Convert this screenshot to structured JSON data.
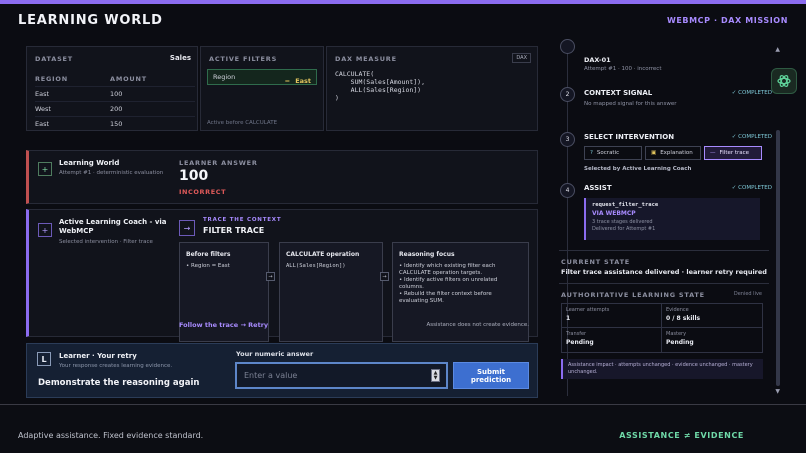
{
  "header": {
    "title": "LEARNING WORLD",
    "mission": "WEBMCP · DAX MISSION"
  },
  "dataset": {
    "label": "DATASET",
    "table_name": "Sales",
    "columns": [
      "REGION",
      "AMOUNT"
    ],
    "rows": [
      [
        "East",
        "100"
      ],
      [
        "West",
        "200"
      ],
      [
        "East",
        "150"
      ]
    ]
  },
  "active_filters": {
    "label": "ACTIVE FILTERS",
    "field": "Region",
    "op": "=",
    "value": "East",
    "note": "Active before CALCULATE"
  },
  "dax_measure": {
    "label": "DAX MEASURE",
    "tag": "DAX",
    "code": "CALCULATE(\n    SUM(Sales[Amount]),\n    ALL(Sales[Region])\n)"
  },
  "learning_world": {
    "title": "Learning World",
    "subtitle": "Attempt #1 · deterministic evaluation",
    "answer_label": "LEARNER ANSWER",
    "answer": "100",
    "verdict": "INCORRECT"
  },
  "coach": {
    "title": "Active Learning Coach - via WebMCP",
    "subtitle": "Selected intervention · Filter trace",
    "kicker": "TRACE THE CONTEXT",
    "heading": "FILTER TRACE",
    "before": {
      "title": "Before filters",
      "items": [
        "Region = East"
      ]
    },
    "calc": {
      "title": "CALCULATE operation",
      "code": "ALL(Sales[Region])"
    },
    "focus": {
      "title": "Reasoning focus",
      "items": [
        "Identify which existing filter each CALCULATE operation targets.",
        "Identify active filters on unrelated columns.",
        "Rebuild the filter context before evaluating SUM."
      ]
    },
    "link": "Follow the trace → Retry",
    "note": "Assistance does not create evidence."
  },
  "retry": {
    "title": "Learner · Your retry",
    "subtitle": "Your response creates learning evidence.",
    "prompt": "Demonstrate the reasoning again",
    "field_label": "Your numeric answer",
    "placeholder": "Enter a value",
    "submit": "Submit prediction"
  },
  "timeline": {
    "top": {
      "id": "DAX-01",
      "sub": "Attempt #1 · 100 · incorrect"
    },
    "steps": [
      {
        "num": "2",
        "title": "CONTEXT SIGNAL",
        "sub": "No mapped signal for this answer",
        "status": "✓ COMPLETED"
      },
      {
        "num": "3",
        "title": "SELECT INTERVENTION",
        "sub": "Selected by Active Learning Coach",
        "status": "✓ COMPLETED"
      },
      {
        "num": "4",
        "title": "ASSIST",
        "status": "✓ COMPLETED"
      }
    ],
    "chips": [
      "Socratic",
      "Explanation",
      "Filter trace"
    ],
    "assist": {
      "call": "request_filter_trace",
      "via": "VIA WEBMCP",
      "l1": "3 trace stages delivered",
      "l2": "Delivered for Attempt #1"
    }
  },
  "current_state": {
    "label": "CURRENT STATE",
    "text": "Filter trace assistance delivered · learner retry required"
  },
  "learning_state": {
    "label": "AUTHORITATIVE LEARNING STATE",
    "badge": "Denied live",
    "cells": [
      {
        "k": "Learner attempts",
        "v": "1"
      },
      {
        "k": "Evidence",
        "v": "0 / 8 skills"
      },
      {
        "k": "Transfer",
        "v": "Pending"
      },
      {
        "k": "Mastery",
        "v": "Pending"
      }
    ],
    "impact": "Assistance impact · attempts unchanged · evidence unchanged · mastery unchanged."
  },
  "footer": {
    "left": "Adaptive assistance. Fixed evidence standard.",
    "right": "ASSISTANCE ≠ EVIDENCE"
  },
  "colors": {
    "accent": "#8b6cf0",
    "success": "#6fd9a8",
    "danger": "#e05a5a"
  }
}
